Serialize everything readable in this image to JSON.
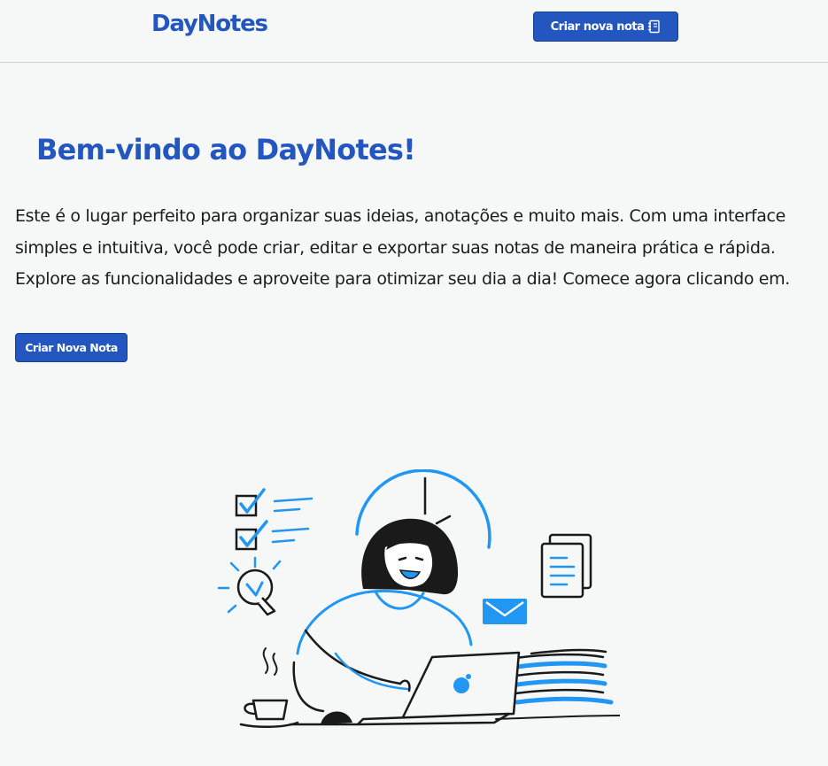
{
  "header": {
    "logo": "DayNotes",
    "create_button_label": "Criar nova nota",
    "create_button_icon": "notebook-icon"
  },
  "main": {
    "title": "Bem-vindo ao DayNotes!",
    "intro": "Este é o lugar perfeito para organizar suas ideias, anotações e muito mais. Com uma interface simples e intuitiva, você pode criar, editar e exportar suas notas de maneira prática e rápida. Explore as funcionalidades e aproveite para otimizar seu dia a dia! Comece agora clicando em.",
    "cta_label": "Criar Nova Nota"
  },
  "illustration": {
    "name": "person-working-on-laptop-illustration",
    "colors": {
      "accent": "#2196f3",
      "ink": "#1a1a1a"
    }
  },
  "colors": {
    "brand": "#2356bf",
    "background": "#f6f8f8",
    "text": "#1b1b1b",
    "divider": "#cfd2d3"
  }
}
